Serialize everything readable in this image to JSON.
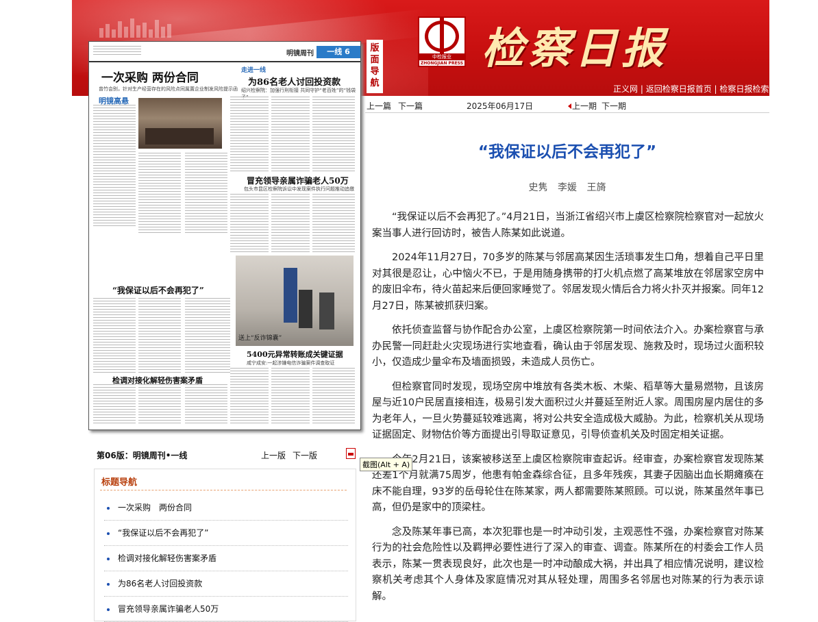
{
  "masthead": {
    "side_tag": "版面导航",
    "logo_text": "中检报业",
    "logo_sub": "ZHONGJIAN PRESS",
    "paper_title": "检察日报",
    "links": [
      "正义网",
      "返回检察日报首页",
      "检察日报检索"
    ]
  },
  "scan": {
    "page_name": "明镜周刊",
    "page_box": "一线 6",
    "h1": "一次采购  两份合同",
    "h1_sub": "曾竹会别，针对生产经营存在的风险点同属置企业制发风险提示函",
    "sec1": "明镜高悬",
    "h2": "为86名老人讨回投资款",
    "h2_tag": "走进一线",
    "h2_sub": "绍兴检察院：加强行刑衔接 共同守护“老百姓”的“钱袋子”",
    "h3": "冒充领导亲属诈骗老人50万",
    "h3_sub": "包头市昆区检察院诉讼中发现案件执行问题推动追缴",
    "h4": "“我保证以后不会再犯了”",
    "h5": "5400元异常转账成关键证据",
    "h5_sub": "咸宁成安:一起涉嫌电信诈骗案件调查取证",
    "h6": "检调对接化解轻伤害案矛盾",
    "photo_caption": "送上“反诈锦囊”"
  },
  "nav": {
    "prev_article": "上一篇",
    "next_article": "下一篇",
    "date": "2025年06月17日",
    "prev_issue": "上一期",
    "next_issue": "下一期"
  },
  "article": {
    "title": "“我保证以后不会再犯了”",
    "authors": "史隽 李媛 王旖",
    "paragraphs": [
      "“我保证以后不会再犯了。”4月21日，当浙江省绍兴市上虞区检察院检察官对一起放火案当事人进行回访时，被告人陈某如此说道。",
      "2024年11月27日，70多岁的陈某与邻居高某因生活琐事发生口角，想着自己平日里对其很是忍让，心中恼火不已，于是用随身携带的打火机点燃了高某堆放在邻居家空房中的废旧伞布，待火苗起来后便回家睡觉了。邻居发现火情后合力将火扑灭并报案。同年12月27日，陈某被抓获归案。",
      "依托侦查监督与协作配合办公室，上虞区检察院第一时间依法介入。办案检察官与承办民警一同赶赴火灾现场进行实地查看，确认由于邻居发现、施救及时，现场过火面积较小，仅造成少量伞布及墙面损毁，未造成人员伤亡。",
      "但检察官同时发现，现场空房中堆放有各类木板、木柴、稻草等大量易燃物，且该房屋与近10户民居直接相连，极易引发大面积过火并蔓延至附近人家。周围房屋内居住的多为老年人，一旦火势蔓延较难逃离，将对公共安全造成极大威胁。为此，检察机关从现场证据固定、财物估价等方面提出引导取证意见，引导侦查机关及时固定相关证据。",
      "今年2月21日，该案被移送至上虞区检察院审查起诉。经审查，办案检察官发现陈某还差1个月就满75周岁，他患有帕金森综合征，且多年残疾，其妻子因脑出血长期瘫痪在床不能自理，93岁的岳母轮住在陈某家，两人都需要陈某照顾。可以说，陈某虽然年事已高，但仍是家中的顶梁柱。",
      "念及陈某年事已高，本次犯罪也是一时冲动引发，主观恶性不强，办案检察官对陈某行为的社会危险性以及羁押必要性进行了深入的审查、调查。陈某所在的村委会工作人员表示，陈某一贯表现良好，此次也是一时冲动酿成大祸，并出具了相应情况说明，建议检察机关考虑其个人身体及家庭情况对其从轻处理，周围多名邻居也对陈某的行为表示谅解。"
    ]
  },
  "page_footer": {
    "page_label": "第06版：明镜周刊•一线",
    "prev_page": "上一版",
    "next_page": "下一版",
    "tooltip": "截图(Alt + A)"
  },
  "title_nav": {
    "heading": "标题导航",
    "items": [
      "一次采购　两份合同",
      "“我保证以后不会再犯了”",
      "检调对接化解轻伤害案矛盾",
      "为86名老人讨回投资款",
      "冒充领导亲属诈骗老人50万"
    ]
  }
}
